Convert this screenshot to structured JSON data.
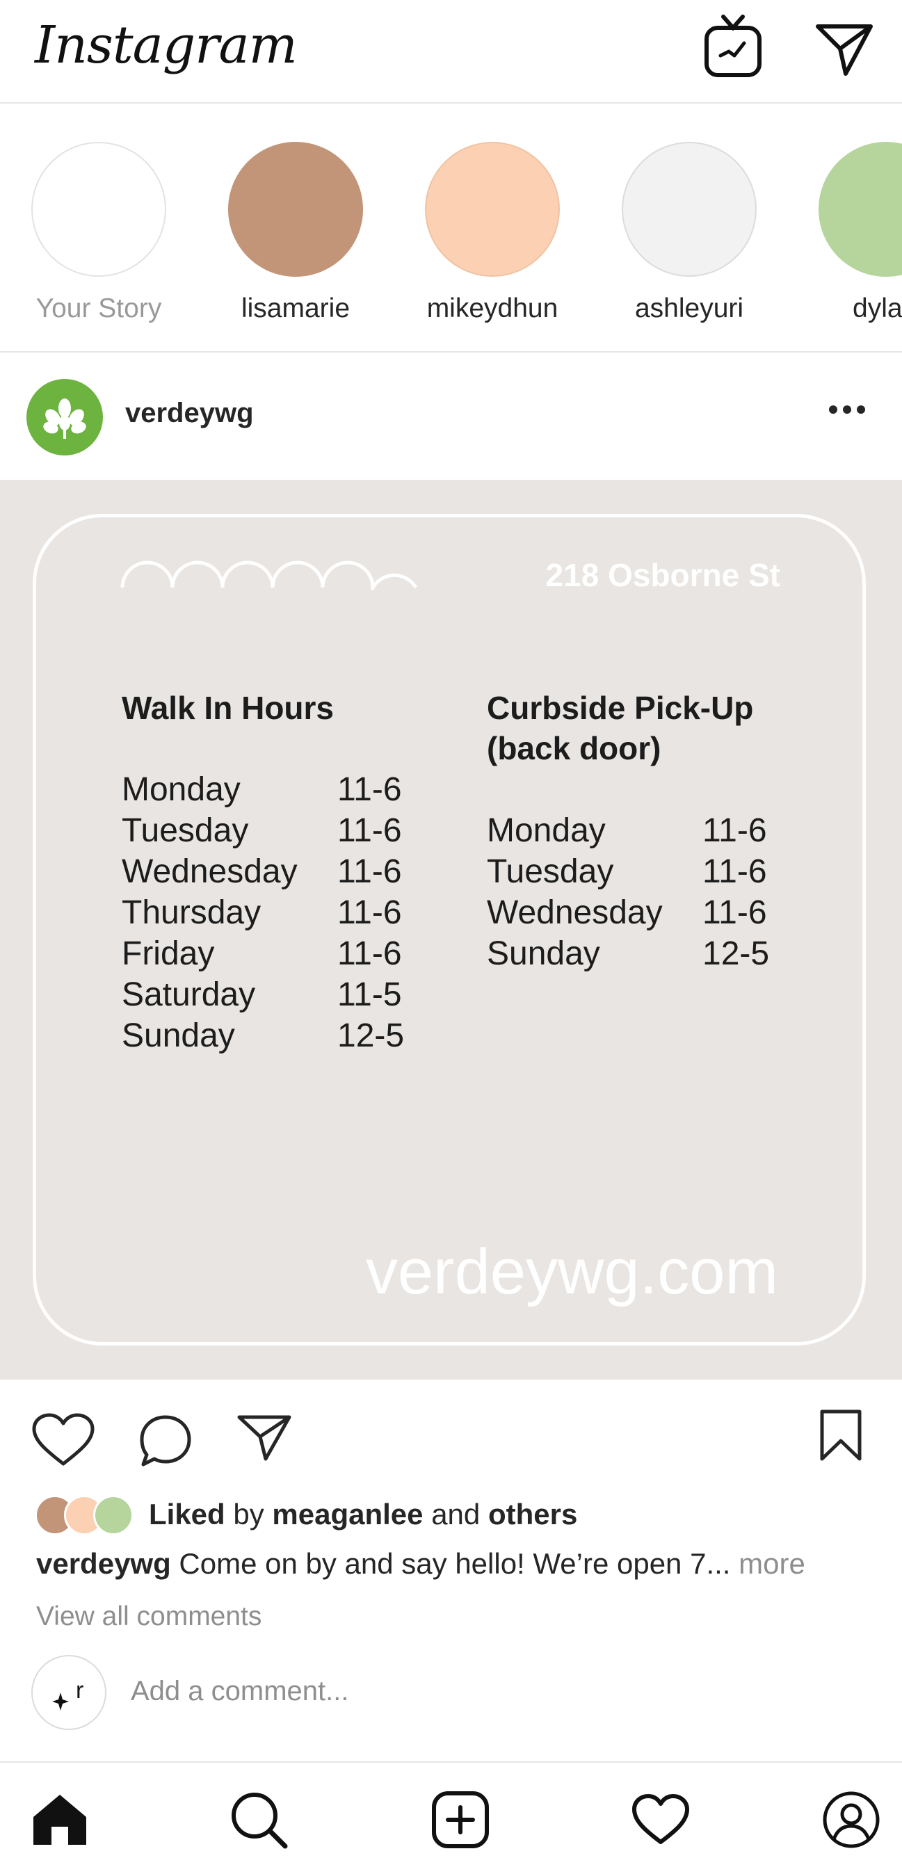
{
  "header": {
    "app_title": "Instagram",
    "igtv_icon": "igtv-icon",
    "direct_icon": "paper-plane-icon"
  },
  "stories": [
    {
      "label": "Your Story",
      "color": "#ffffff",
      "border": "#e0e0e0",
      "muted": true
    },
    {
      "label": "lisamarie",
      "color": "#c29478",
      "border": "#c29478",
      "muted": false
    },
    {
      "label": "mikeydhun",
      "color": "#fcd0b2",
      "border": "#f3c6a8",
      "muted": false
    },
    {
      "label": "ashleyuri",
      "color": "#f2f2f2",
      "border": "#dddddd",
      "muted": false
    },
    {
      "label": "dyla",
      "color": "#b5d59c",
      "border": "#b5d59c",
      "muted": false
    }
  ],
  "post": {
    "username": "verdeywg",
    "avatar_color": "#6db33f",
    "image": {
      "address": "218 Osborne St",
      "website": "verdeywg.com",
      "walk_in": {
        "title": "Walk In Hours",
        "rows": [
          {
            "day": "Monday",
            "time": "11-6"
          },
          {
            "day": "Tuesday",
            "time": "11-6"
          },
          {
            "day": "Wednesday",
            "time": "11-6"
          },
          {
            "day": "Thursday",
            "time": "11-6"
          },
          {
            "day": "Friday",
            "time": "11-6"
          },
          {
            "day": "Saturday",
            "time": "11-5"
          },
          {
            "day": "Sunday",
            "time": "12-5"
          }
        ]
      },
      "curbside": {
        "title_line1": "Curbside Pick-Up",
        "title_line2": "(back door)",
        "rows": [
          {
            "day": "Monday",
            "time": "11-6"
          },
          {
            "day": "Tuesday",
            "time": "11-6"
          },
          {
            "day": "Wednesday",
            "time": "11-6"
          },
          {
            "day": "Sunday",
            "time": "12-5"
          }
        ]
      }
    },
    "likes": {
      "liked": "Liked",
      "by": " by ",
      "user": "meaganlee",
      "and": " and ",
      "others": "others",
      "avatar_colors": [
        "#c29478",
        "#fcd0b2",
        "#b5d59c"
      ]
    },
    "caption": {
      "user": "verdeywg",
      "text": " Come on by and say hello! We’re open 7... ",
      "more": "more"
    },
    "view_comments": "View all comments",
    "add_comment_placeholder": "Add a comment...",
    "my_avatar_text": "r"
  },
  "nav": [
    "home-icon",
    "search-icon",
    "add-post-icon",
    "activity-heart-icon",
    "profile-icon"
  ]
}
